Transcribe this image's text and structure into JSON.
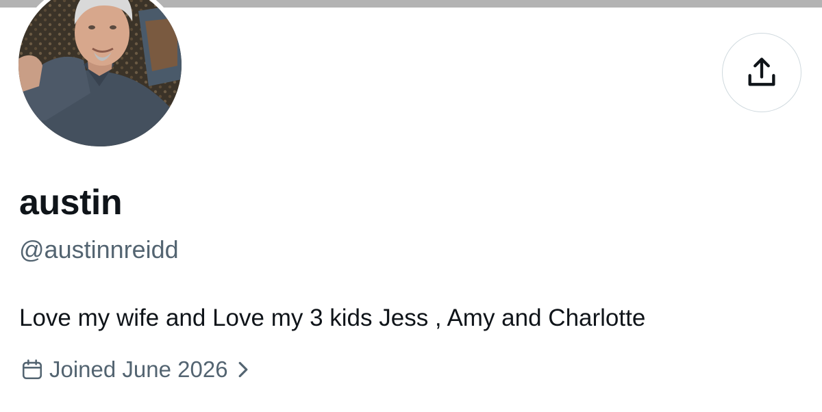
{
  "profile": {
    "display_name": "austin",
    "handle": "@austinnreidd",
    "bio": "Love my wife and Love my 3 kids Jess , Amy and Charlotte",
    "joined": "Joined June 2026",
    "avatar": "profile-photo"
  },
  "actions": {
    "share_icon": "share-upload-icon"
  },
  "icons": {
    "calendar": "calendar-icon",
    "chevron": "chevron-right-icon"
  },
  "colors": {
    "text_primary": "#0f1419",
    "text_secondary": "#536471",
    "border": "#cfd9de",
    "banner": "#b3b3b3"
  }
}
